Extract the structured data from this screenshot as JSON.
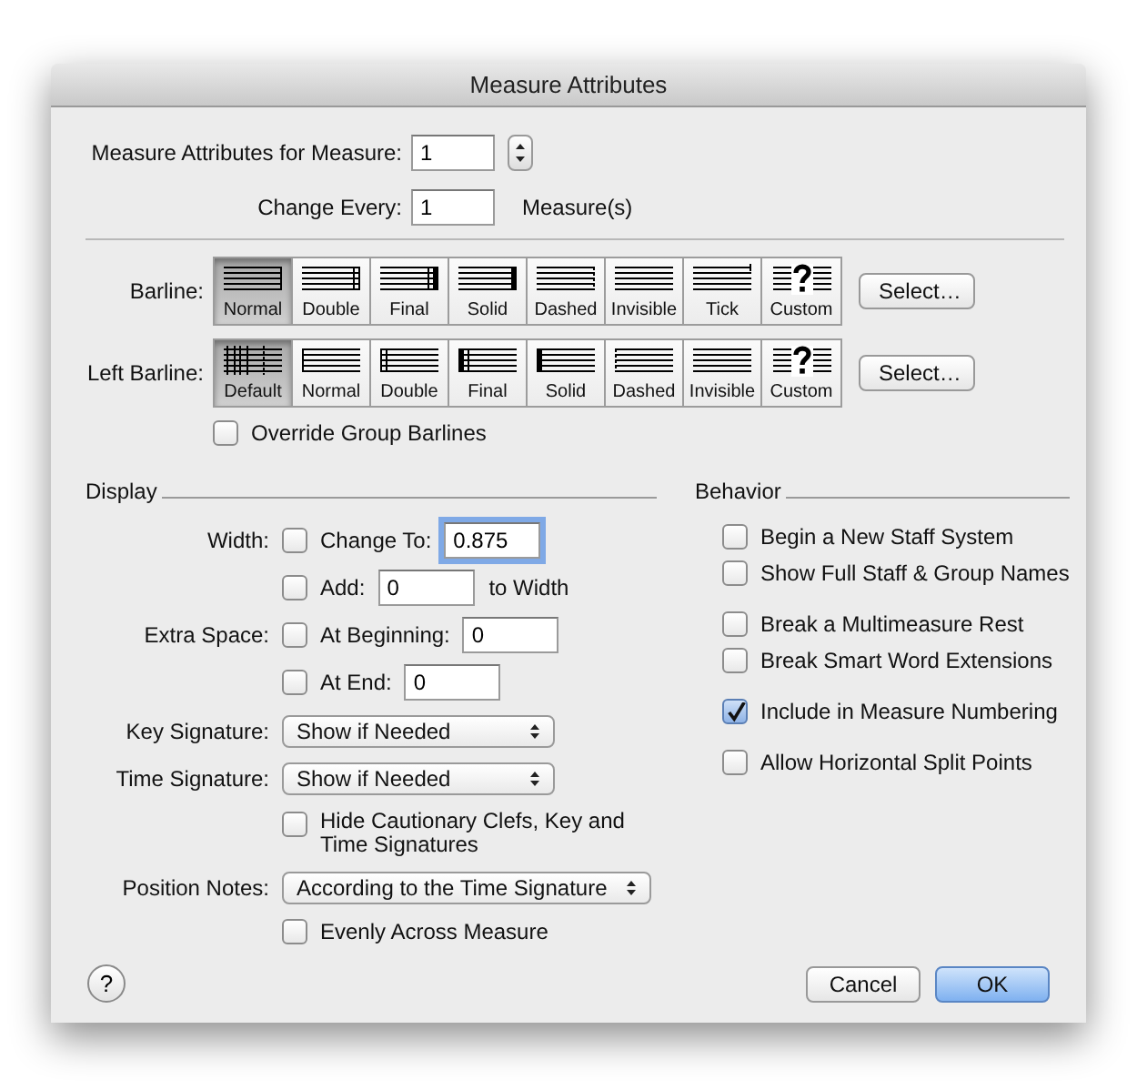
{
  "window": {
    "title": "Measure Attributes"
  },
  "measure": {
    "label": "Measure Attributes for Measure:",
    "value": "1"
  },
  "change_every": {
    "label": "Change Every:",
    "value": "1",
    "unit": "Measure(s)"
  },
  "barline_groups": [
    {
      "label": "Barline:",
      "kind": "right",
      "button": "Select…",
      "options": [
        {
          "label": "Normal",
          "kind": "normal",
          "selected": true
        },
        {
          "label": "Double",
          "kind": "double",
          "selected": false
        },
        {
          "label": "Final",
          "kind": "final",
          "selected": false
        },
        {
          "label": "Solid",
          "kind": "solid",
          "selected": false
        },
        {
          "label": "Dashed",
          "kind": "dashed",
          "selected": false
        },
        {
          "label": "Invisible",
          "kind": "invisible",
          "selected": false
        },
        {
          "label": "Tick",
          "kind": "tick",
          "selected": false
        },
        {
          "label": "Custom",
          "kind": "custom",
          "selected": false
        }
      ]
    },
    {
      "label": "Left Barline:",
      "kind": "left",
      "button": "Select…",
      "options": [
        {
          "label": "Default",
          "kind": "default",
          "selected": true
        },
        {
          "label": "Normal",
          "kind": "normal",
          "selected": false
        },
        {
          "label": "Double",
          "kind": "double",
          "selected": false
        },
        {
          "label": "Final",
          "kind": "final",
          "selected": false
        },
        {
          "label": "Solid",
          "kind": "solid",
          "selected": false
        },
        {
          "label": "Dashed",
          "kind": "dashed",
          "selected": false
        },
        {
          "label": "Invisible",
          "kind": "invisible",
          "selected": false
        },
        {
          "label": "Custom",
          "kind": "custom",
          "selected": false
        }
      ]
    }
  ],
  "override": {
    "label": "Override Group Barlines",
    "checked": false
  },
  "display": {
    "title": "Display",
    "width": {
      "label": "Width:",
      "change_to": {
        "label": "Change To:",
        "checked": false,
        "value": "0.875",
        "focused": true
      },
      "add": {
        "label": "Add:",
        "checked": false,
        "value": "0",
        "suffix": "to Width"
      }
    },
    "extra_space": {
      "label": "Extra Space:",
      "at_beginning": {
        "label": "At Beginning:",
        "checked": false,
        "value": "0"
      },
      "at_end": {
        "label": "At End:",
        "checked": false,
        "value": "0"
      }
    },
    "key_signature": {
      "label": "Key Signature:",
      "value": "Show if Needed"
    },
    "time_signature": {
      "label": "Time Signature:",
      "value": "Show if Needed"
    },
    "hide_cautionary": {
      "label": "Hide Cautionary Clefs, Key and Time Signatures",
      "checked": false
    },
    "position_notes": {
      "label": "Position Notes:",
      "value": "According to the Time Signature"
    },
    "evenly": {
      "label": "Evenly Across Measure",
      "checked": false
    }
  },
  "behavior": {
    "title": "Behavior",
    "groups": [
      {
        "options": [
          {
            "label": "Begin a New Staff System",
            "checked": false
          },
          {
            "label": "Show Full Staff & Group Names",
            "checked": false
          }
        ]
      },
      {
        "options": [
          {
            "label": "Break a Multimeasure Rest",
            "checked": false
          },
          {
            "label": "Break Smart Word Extensions",
            "checked": false
          }
        ]
      },
      {
        "options": [
          {
            "label": "Include in Measure Numbering",
            "checked": true
          }
        ]
      },
      {
        "options": [
          {
            "label": "Allow Horizontal Split Points",
            "checked": false
          }
        ]
      }
    ]
  },
  "help": {
    "label": "?"
  },
  "buttons": [
    {
      "label": "Cancel",
      "default": false
    },
    {
      "label": "OK",
      "default": true
    }
  ]
}
